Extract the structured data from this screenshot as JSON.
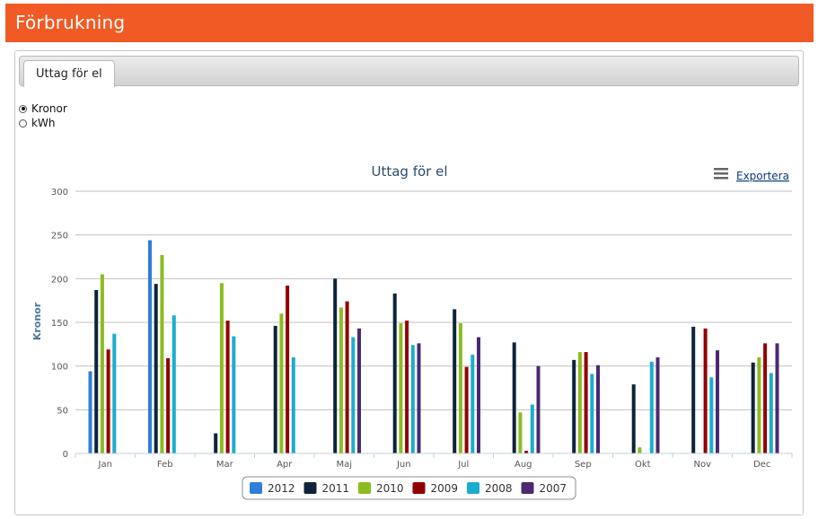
{
  "header": {
    "title": "Förbrukning"
  },
  "tabs": [
    {
      "label": "Uttag för el",
      "active": true
    }
  ],
  "unit_options": [
    {
      "label": "Kronor",
      "checked": true
    },
    {
      "label": "kWh",
      "checked": false
    }
  ],
  "export_label": "Exportera",
  "export_icon": "menu-icon",
  "colors": {
    "header_bg": "#f15a24",
    "series": [
      "#2f7ed8",
      "#0d233a",
      "#8bbc21",
      "#910000",
      "#1aadce",
      "#492970"
    ]
  },
  "chart_data": {
    "type": "bar",
    "title": "Uttag för el",
    "xlabel": "",
    "ylabel": "Kronor",
    "ylim": [
      0,
      300
    ],
    "yticks": [
      0,
      50,
      100,
      150,
      200,
      250,
      300
    ],
    "grid": true,
    "legend_position": "bottom-center",
    "categories": [
      "Jan",
      "Feb",
      "Mar",
      "Apr",
      "Maj",
      "Jun",
      "Jul",
      "Aug",
      "Sep",
      "Okt",
      "Nov",
      "Dec"
    ],
    "series": [
      {
        "name": "2012",
        "color": "#2f7ed8",
        "values": [
          94,
          244,
          null,
          null,
          null,
          null,
          null,
          null,
          null,
          null,
          null,
          null
        ]
      },
      {
        "name": "2011",
        "color": "#0d233a",
        "values": [
          187,
          194,
          23,
          146,
          200,
          183,
          165,
          127,
          107,
          79,
          145,
          104
        ]
      },
      {
        "name": "2010",
        "color": "#8bbc21",
        "values": [
          205,
          227,
          195,
          160,
          167,
          149,
          149,
          47,
          116,
          7,
          null,
          110
        ]
      },
      {
        "name": "2009",
        "color": "#910000",
        "values": [
          119,
          109,
          152,
          192,
          174,
          152,
          99,
          3,
          116,
          null,
          143,
          126
        ]
      },
      {
        "name": "2008",
        "color": "#1aadce",
        "values": [
          137,
          158,
          134,
          110,
          133,
          124,
          113,
          56,
          91,
          105,
          87,
          92
        ]
      },
      {
        "name": "2007",
        "color": "#492970",
        "values": [
          null,
          null,
          null,
          null,
          143,
          126,
          133,
          100,
          101,
          110,
          118,
          126
        ]
      }
    ]
  }
}
